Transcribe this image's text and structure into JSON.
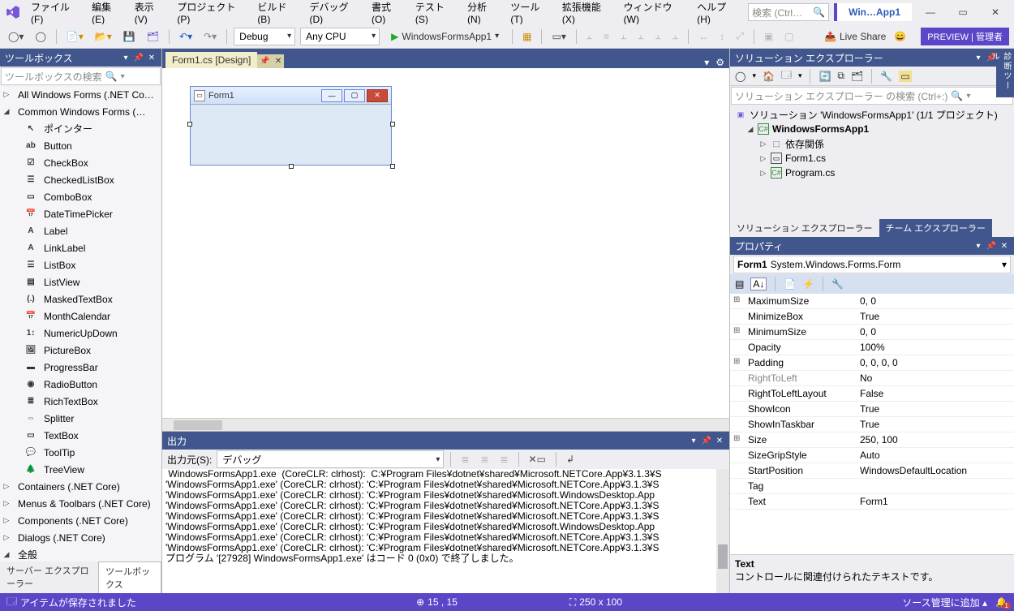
{
  "title_project": "Win…App1",
  "menu": [
    "ファイル(F)",
    "編集(E)",
    "表示(V)",
    "プロジェクト(P)",
    "ビルド(B)",
    "デバッグ(D)",
    "書式(O)",
    "テスト(S)",
    "分析(N)",
    "ツール(T)",
    "拡張機能(X)",
    "ウィンドウ(W)",
    "ヘルプ(H)"
  ],
  "search_placeholder": "検索 (Ctrl…",
  "toolbar": {
    "config": "Debug",
    "platform": "Any CPU",
    "start": "WindowsFormsApp1",
    "live_share": "Live Share",
    "preview": "PREVIEW | 管理者"
  },
  "toolbox": {
    "title": "ツールボックス",
    "search": "ツールボックスの検索",
    "groups": [
      {
        "label": "All Windows Forms (.NET Co…",
        "open": false
      },
      {
        "label": "Common Windows Forms (…",
        "open": true,
        "items": [
          {
            "icon": "↖",
            "label": "ポインター"
          },
          {
            "icon": "ab",
            "label": "Button"
          },
          {
            "icon": "☑",
            "label": "CheckBox"
          },
          {
            "icon": "☰",
            "label": "CheckedListBox"
          },
          {
            "icon": "▭",
            "label": "ComboBox"
          },
          {
            "icon": "📅",
            "label": "DateTimePicker"
          },
          {
            "icon": "A",
            "label": "Label"
          },
          {
            "icon": "A",
            "label": "LinkLabel"
          },
          {
            "icon": "☰",
            "label": "ListBox"
          },
          {
            "icon": "▤",
            "label": "ListView"
          },
          {
            "icon": "(.)",
            "label": "MaskedTextBox"
          },
          {
            "icon": "📅",
            "label": "MonthCalendar"
          },
          {
            "icon": "1↕",
            "label": "NumericUpDown"
          },
          {
            "icon": "🖼",
            "label": "PictureBox"
          },
          {
            "icon": "▬",
            "label": "ProgressBar"
          },
          {
            "icon": "◉",
            "label": "RadioButton"
          },
          {
            "icon": "≣",
            "label": "RichTextBox"
          },
          {
            "icon": "⇔",
            "label": "Splitter"
          },
          {
            "icon": "▭",
            "label": "TextBox"
          },
          {
            "icon": "💬",
            "label": "ToolTip"
          },
          {
            "icon": "🌲",
            "label": "TreeView"
          }
        ]
      },
      {
        "label": "Containers (.NET Core)",
        "open": false
      },
      {
        "label": "Menus & Toolbars (.NET Core)",
        "open": false
      },
      {
        "label": "Components (.NET Core)",
        "open": false
      },
      {
        "label": "Dialogs (.NET Core)",
        "open": false
      },
      {
        "label": "全般",
        "open": true
      }
    ],
    "tabs": [
      "サーバー エクスプローラー",
      "ツールボックス"
    ]
  },
  "doc_tab": "Form1.cs [Design]",
  "form_caption": "Form1",
  "output": {
    "title": "出力",
    "source_label": "出力元(S):",
    "source": "デバッグ",
    "lines": [
      " WindowsFormsApp1.exe  (CoreCLR: clrhost):  C:¥Program Files¥dotnet¥shared¥Microsoft.NETCore.App¥3.1.3¥S",
      "'WindowsFormsApp1.exe' (CoreCLR: clrhost): 'C:¥Program Files¥dotnet¥shared¥Microsoft.NETCore.App¥3.1.3¥S",
      "'WindowsFormsApp1.exe' (CoreCLR: clrhost): 'C:¥Program Files¥dotnet¥shared¥Microsoft.WindowsDesktop.App",
      "'WindowsFormsApp1.exe' (CoreCLR: clrhost): 'C:¥Program Files¥dotnet¥shared¥Microsoft.NETCore.App¥3.1.3¥S",
      "'WindowsFormsApp1.exe' (CoreCLR: clrhost): 'C:¥Program Files¥dotnet¥shared¥Microsoft.NETCore.App¥3.1.3¥S",
      "'WindowsFormsApp1.exe' (CoreCLR: clrhost): 'C:¥Program Files¥dotnet¥shared¥Microsoft.WindowsDesktop.App",
      "'WindowsFormsApp1.exe' (CoreCLR: clrhost): 'C:¥Program Files¥dotnet¥shared¥Microsoft.NETCore.App¥3.1.3¥S",
      "'WindowsFormsApp1.exe' (CoreCLR: clrhost): 'C:¥Program Files¥dotnet¥shared¥Microsoft.NETCore.App¥3.1.3¥S",
      "プログラム '[27928] WindowsFormsApp1.exe' はコード 0 (0x0) で終了しました。"
    ]
  },
  "solution": {
    "title": "ソリューション エクスプローラー",
    "search": "ソリューション エクスプローラー の検索 (Ctrl+:)",
    "root": "ソリューション 'WindowsFormsApp1' (1/1 プロジェクト)",
    "project": "WindowsFormsApp1",
    "deps": "依存関係",
    "form": "Form1.cs",
    "program": "Program.cs",
    "tabs": [
      "ソリューション エクスプローラー",
      "チーム エクスプローラー"
    ]
  },
  "properties": {
    "title": "プロパティ",
    "selector_name": "Form1",
    "selector_type": "System.Windows.Forms.Form",
    "rows": [
      {
        "name": "MaximumSize",
        "val": "0, 0",
        "exp": true
      },
      {
        "name": "MinimizeBox",
        "val": "True"
      },
      {
        "name": "MinimumSize",
        "val": "0, 0",
        "exp": true
      },
      {
        "name": "Opacity",
        "val": "100%"
      },
      {
        "name": "Padding",
        "val": "0, 0, 0, 0",
        "exp": true
      },
      {
        "name": "RightToLeft",
        "val": "No",
        "dim": true
      },
      {
        "name": "RightToLeftLayout",
        "val": "False"
      },
      {
        "name": "ShowIcon",
        "val": "True"
      },
      {
        "name": "ShowInTaskbar",
        "val": "True"
      },
      {
        "name": "Size",
        "val": "250, 100",
        "exp": true
      },
      {
        "name": "SizeGripStyle",
        "val": "Auto"
      },
      {
        "name": "StartPosition",
        "val": "WindowsDefaultLocation"
      },
      {
        "name": "Tag",
        "val": ""
      },
      {
        "name": "Text",
        "val": "Form1"
      }
    ],
    "help_name": "Text",
    "help_desc": "コントロールに関連付けられたテキストです。"
  },
  "status": {
    "msg": "アイテムが保存されました",
    "pos": "15 , 15",
    "size": "250 x 100",
    "source": "ソース管理に追加",
    "notif": "1"
  },
  "rightgutter": "診断ツール"
}
